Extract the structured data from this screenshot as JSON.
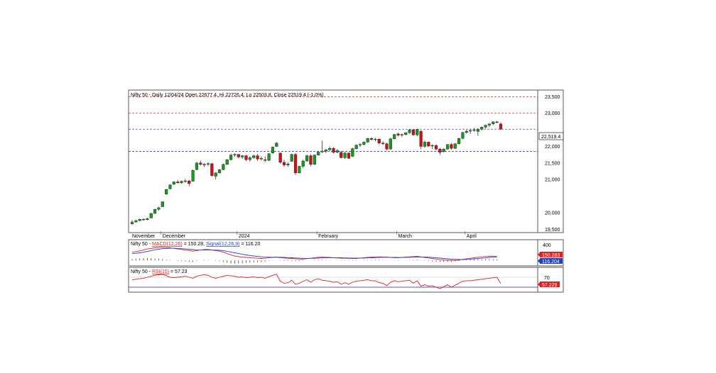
{
  "main_panel": {
    "title": "Nifty 50 - Daily 12/04/24 Open 22677.4, Hi 22726.4, Lo 22503.8, Close 22519.4 (-1.0%)",
    "x_labels": [
      "November",
      "December",
      "2024",
      "February",
      "March",
      "April"
    ],
    "y_ticks": [
      "23,500",
      "23,000",
      "22,000",
      "21,500",
      "21,000",
      "20,000",
      "19,500"
    ],
    "last_price_label": "22,519.4"
  },
  "macd_panel": {
    "prefix": "Nifty 50 - ",
    "macd_label": "MACD(12,26)",
    "macd_value": " = 150.28, ",
    "signal_label": "Signal(12,26,9)",
    "signal_value": " = 116.20",
    "y_tick": "400",
    "macd_tag": "150.283",
    "signal_tag": "116.204"
  },
  "rsi_panel": {
    "prefix": "Nifty 50 - ",
    "rsi_label": "RSI(15)",
    "rsi_value": " = 57.23",
    "y_tick": "70",
    "rsi_tag": "57.229"
  },
  "colors": {
    "up": "#1a9a1a",
    "down": "#d01010",
    "macd_line": "#e02020",
    "signal_line": "#2040e0",
    "resistance": "#e02020",
    "support": "#2020c0"
  },
  "chart_data": {
    "type": "candlestick",
    "title": "Nifty 50 - Daily 12/04/24 Open 22677.4, Hi 22726.4, Lo 22503.8, Close 22519.4 (-1.0%)",
    "y_range": [
      19400,
      23700
    ],
    "horizontal_levels": [
      {
        "value": 23500,
        "style": "dashed",
        "color": "#e02020"
      },
      {
        "value": 23000,
        "style": "dashed",
        "color": "#e02020"
      },
      {
        "value": 22519.4,
        "style": "dashed",
        "color": "#2020c0"
      },
      {
        "value": 21850,
        "style": "dashed",
        "color": "#2020c0"
      }
    ],
    "candles": [
      [
        19660,
        19780,
        19640,
        19720
      ],
      [
        19720,
        19790,
        19700,
        19760
      ],
      [
        19760,
        19820,
        19740,
        19800
      ],
      [
        19800,
        19830,
        19760,
        19790
      ],
      [
        19790,
        19850,
        19770,
        19820
      ],
      [
        19840,
        19990,
        19830,
        19980
      ],
      [
        19980,
        20120,
        19960,
        20100
      ],
      [
        20100,
        20180,
        20060,
        20150
      ],
      [
        20180,
        20340,
        20170,
        20330
      ],
      [
        20560,
        20720,
        20540,
        20700
      ],
      [
        20720,
        20860,
        20700,
        20840
      ],
      [
        20860,
        20950,
        20830,
        20930
      ],
      [
        20930,
        20990,
        20880,
        20900
      ],
      [
        20900,
        20970,
        20870,
        20950
      ],
      [
        20960,
        21020,
        20900,
        20940
      ],
      [
        20960,
        20990,
        20800,
        20880
      ],
      [
        20950,
        21300,
        20940,
        21280
      ],
      [
        21300,
        21530,
        21280,
        21500
      ],
      [
        21500,
        21570,
        21420,
        21460
      ],
      [
        21460,
        21500,
        21380,
        21440
      ],
      [
        21460,
        21520,
        21400,
        21480
      ],
      [
        21480,
        21500,
        21090,
        21120
      ],
      [
        21100,
        21220,
        21000,
        21200
      ],
      [
        21200,
        21320,
        21180,
        21300
      ],
      [
        21300,
        21480,
        21280,
        21460
      ],
      [
        21460,
        21620,
        21440,
        21600
      ],
      [
        21600,
        21780,
        21580,
        21740
      ],
      [
        21740,
        21790,
        21680,
        21760
      ],
      [
        21760,
        21770,
        21650,
        21680
      ],
      [
        21680,
        21740,
        21620,
        21720
      ],
      [
        21720,
        21750,
        21560,
        21600
      ],
      [
        21600,
        21700,
        21540,
        21660
      ],
      [
        21660,
        21750,
        21620,
        21720
      ],
      [
        21720,
        21780,
        21560,
        21620
      ],
      [
        21620,
        21700,
        21580,
        21640
      ],
      [
        21600,
        21700,
        21520,
        21580
      ],
      [
        21580,
        21800,
        21560,
        21780
      ],
      [
        21800,
        22000,
        21780,
        21980
      ],
      [
        22000,
        22130,
        21980,
        22100
      ],
      [
        21800,
        21810,
        21480,
        21520
      ],
      [
        21520,
        21600,
        21380,
        21440
      ],
      [
        21440,
        21520,
        21380,
        21470
      ],
      [
        21550,
        21780,
        21530,
        21760
      ],
      [
        21760,
        21800,
        21140,
        21200
      ],
      [
        21200,
        21420,
        21180,
        21400
      ],
      [
        21400,
        21600,
        21340,
        21560
      ],
      [
        21560,
        21750,
        21540,
        21720
      ],
      [
        21720,
        21760,
        21400,
        21460
      ],
      [
        21460,
        21760,
        21440,
        21740
      ],
      [
        21740,
        21850,
        21720,
        21830
      ],
      [
        21830,
        22170,
        21810,
        21860
      ],
      [
        21860,
        21920,
        21800,
        21900
      ],
      [
        21900,
        22000,
        21860,
        21940
      ],
      [
        21940,
        21980,
        21780,
        21820
      ],
      [
        21820,
        21920,
        21800,
        21880
      ],
      [
        21820,
        21860,
        21640,
        21660
      ],
      [
        21660,
        21830,
        21620,
        21800
      ],
      [
        21800,
        21820,
        21620,
        21640
      ],
      [
        21700,
        21960,
        21680,
        21930
      ],
      [
        21930,
        22060,
        21910,
        22040
      ],
      [
        22040,
        22100,
        21980,
        22060
      ],
      [
        22060,
        22150,
        22030,
        22130
      ],
      [
        22130,
        22260,
        22110,
        22240
      ],
      [
        22240,
        22280,
        22180,
        22210
      ],
      [
        22210,
        22260,
        22150,
        22220
      ],
      [
        22220,
        22240,
        22060,
        22100
      ],
      [
        22100,
        22160,
        22040,
        22080
      ],
      [
        22080,
        22110,
        21880,
        21920
      ],
      [
        21920,
        22260,
        21900,
        22230
      ],
      [
        22230,
        22380,
        22210,
        22360
      ],
      [
        22380,
        22410,
        22300,
        22340
      ],
      [
        22340,
        22390,
        22280,
        22360
      ],
      [
        22360,
        22430,
        22330,
        22410
      ],
      [
        22410,
        22520,
        22380,
        22500
      ],
      [
        22500,
        22520,
        22320,
        22350
      ],
      [
        22350,
        22530,
        22300,
        22510
      ],
      [
        22460,
        22480,
        21920,
        22000
      ],
      [
        22000,
        22180,
        21960,
        22130
      ],
      [
        22130,
        22150,
        21990,
        22010
      ],
      [
        22010,
        22060,
        21920,
        22030
      ],
      [
        22030,
        22060,
        21880,
        21920
      ],
      [
        21920,
        21960,
        21740,
        21820
      ],
      [
        21840,
        21940,
        21820,
        21920
      ],
      [
        21920,
        22070,
        21900,
        22060
      ],
      [
        22060,
        22100,
        21900,
        21940
      ],
      [
        21940,
        22100,
        21920,
        22080
      ],
      [
        22080,
        22260,
        22060,
        22240
      ],
      [
        22240,
        22440,
        22220,
        22420
      ],
      [
        22420,
        22500,
        22380,
        22460
      ],
      [
        22460,
        22520,
        22380,
        22480
      ],
      [
        22480,
        22560,
        22440,
        22500
      ],
      [
        22450,
        22550,
        22320,
        22520
      ],
      [
        22520,
        22600,
        22480,
        22580
      ],
      [
        22580,
        22660,
        22540,
        22640
      ],
      [
        22640,
        22700,
        22580,
        22680
      ],
      [
        22680,
        22760,
        22640,
        22740
      ],
      [
        22740,
        22770,
        22700,
        22720
      ],
      [
        22677.4,
        22726.4,
        22503.8,
        22519.4
      ]
    ],
    "macd": {
      "macd_last": 150.28,
      "signal_last": 116.2,
      "macd_line": [
        300,
        320,
        350,
        380,
        420,
        440,
        460,
        470,
        480,
        470,
        460,
        440,
        420,
        400,
        380,
        360,
        340,
        360,
        380,
        400,
        400,
        380,
        360,
        340,
        300,
        250,
        200,
        160,
        140,
        120,
        110,
        100,
        90,
        80,
        70,
        80,
        100,
        110,
        120,
        100,
        90,
        80,
        70,
        60,
        50,
        50,
        70,
        80,
        100,
        110,
        120,
        115,
        110,
        100,
        90,
        85,
        80,
        75,
        70,
        70,
        85,
        100,
        110,
        120,
        125,
        130,
        125,
        120,
        110,
        100,
        95,
        110,
        120,
        130,
        140,
        150,
        130,
        110,
        90,
        70,
        50,
        30,
        15,
        5,
        0,
        0,
        10,
        40,
        60,
        80,
        100,
        115,
        130,
        140,
        150,
        155,
        150.28
      ],
      "signal_line": [
        250,
        260,
        280,
        300,
        330,
        360,
        390,
        410,
        430,
        440,
        445,
        445,
        440,
        430,
        420,
        410,
        395,
        385,
        380,
        380,
        382,
        381,
        377,
        370,
        356,
        335,
        308,
        278,
        250,
        224,
        201,
        181,
        163,
        146,
        131,
        121,
        117,
        116,
        117,
        114,
        109,
        103,
        96,
        89,
        81,
        75,
        74,
        75,
        80,
        86,
        93,
        97,
        100,
        100,
        98,
        96,
        93,
        90,
        86,
        83,
        83,
        86,
        91,
        97,
        103,
        108,
        112,
        113,
        113,
        110,
        107,
        108,
        110,
        114,
        119,
        125,
        126,
        123,
        117,
        108,
        97,
        83,
        70,
        57,
        46,
        37,
        31,
        33,
        38,
        47,
        57,
        69,
        81,
        93,
        104,
        114,
        116.2
      ],
      "histogram": [
        50,
        60,
        70,
        80,
        90,
        80,
        70,
        60,
        50,
        30,
        15,
        -5,
        -20,
        -30,
        -40,
        -50,
        -55,
        -25,
        0,
        20,
        18,
        -1,
        -17,
        -30,
        -56,
        -85,
        -108,
        -118,
        -110,
        -104,
        -91,
        -81,
        -73,
        -66,
        -61,
        -41,
        -17,
        -6,
        3,
        -14,
        -19,
        -23,
        -26,
        -29,
        -31,
        -25,
        -4,
        5,
        20,
        24,
        27,
        18,
        10,
        0,
        -8,
        -11,
        -13,
        -15,
        -16,
        -13,
        2,
        14,
        19,
        23,
        22,
        22,
        13,
        7,
        -3,
        -10,
        -12,
        2,
        10,
        16,
        21,
        25,
        4,
        -13,
        -27,
        -38,
        -47,
        -53,
        -55,
        -52,
        -46,
        -37,
        -21,
        7,
        22,
        33,
        43,
        46,
        49,
        47,
        46,
        41,
        34
      ]
    },
    "rsi": {
      "last": 57.23,
      "upper": 70,
      "lower": 50,
      "values": [
        65,
        66,
        67,
        68,
        70,
        72,
        74,
        75,
        76,
        73,
        70,
        69,
        70,
        71,
        72,
        70,
        68,
        72,
        74,
        75,
        74,
        70,
        68,
        70,
        72,
        74,
        73,
        72,
        70,
        71,
        69,
        70,
        71,
        69,
        70,
        68,
        71,
        74,
        76,
        62,
        58,
        59,
        64,
        56,
        58,
        62,
        65,
        60,
        65,
        67,
        64,
        63,
        62,
        60,
        61,
        56,
        59,
        56,
        60,
        62,
        63,
        64,
        65,
        63,
        63,
        59,
        58,
        53,
        60,
        63,
        61,
        62,
        63,
        64,
        58,
        63,
        52,
        55,
        52,
        53,
        50,
        47,
        51,
        55,
        50,
        54,
        58,
        62,
        63,
        63,
        64,
        65,
        66,
        67,
        68,
        69,
        70,
        57.23
      ]
    }
  }
}
